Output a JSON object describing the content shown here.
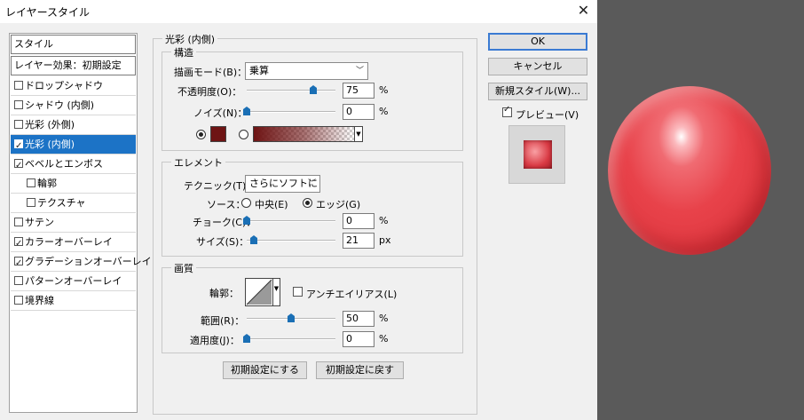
{
  "window": {
    "title": "レイヤースタイル",
    "close_glyph": "✕"
  },
  "list": {
    "header1": "スタイル",
    "header2": "レイヤー効果：初期設定",
    "items": [
      {
        "label": "ドロップシャドウ",
        "checked": false,
        "indent": false,
        "selected": false
      },
      {
        "label": "シャドウ (内側)",
        "checked": false,
        "indent": false,
        "selected": false
      },
      {
        "label": "光彩 (外側)",
        "checked": false,
        "indent": false,
        "selected": false
      },
      {
        "label": "光彩 (内側)",
        "checked": true,
        "indent": false,
        "selected": true
      },
      {
        "label": "ベベルとエンボス",
        "checked": true,
        "indent": false,
        "selected": false
      },
      {
        "label": "輪郭",
        "checked": false,
        "indent": true,
        "selected": false
      },
      {
        "label": "テクスチャ",
        "checked": false,
        "indent": true,
        "selected": false
      },
      {
        "label": "サテン",
        "checked": false,
        "indent": false,
        "selected": false
      },
      {
        "label": "カラーオーバーレイ",
        "checked": true,
        "indent": false,
        "selected": false
      },
      {
        "label": "グラデーションオーバーレイ",
        "checked": true,
        "indent": false,
        "selected": false
      },
      {
        "label": "パターンオーバーレイ",
        "checked": false,
        "indent": false,
        "selected": false
      },
      {
        "label": "境界線",
        "checked": false,
        "indent": false,
        "selected": false
      }
    ]
  },
  "panel": {
    "title": "光彩 (内側)",
    "structure": {
      "title": "構造",
      "blend_label": "描画モード(B)：",
      "blend_value": "乗算",
      "opacity_label": "不透明度(O)：",
      "opacity_value": "75",
      "opacity_unit": "%",
      "opacity": 75,
      "noise_label": "ノイズ(N)：",
      "noise_value": "0",
      "noise_unit": "%",
      "noise": 0,
      "color_swatch": "#6e1414",
      "gradient_from": "#6e1414"
    },
    "elements": {
      "title": "エレメント",
      "technique_label": "テクニック(T)：",
      "technique_value": "さらにソフトに",
      "source_label": "ソース：",
      "center_label": "中央(E)",
      "edge_label": "エッジ(G)",
      "choke_label": "チョーク(C)：",
      "choke_value": "0",
      "choke_unit": "%",
      "choke": 0,
      "size_label": "サイズ(S)：",
      "size_value": "21",
      "size_unit": "px",
      "size": 21
    },
    "quality": {
      "title": "画質",
      "contour_label": "輪郭：",
      "antialias_label": "アンチエイリアス(L)",
      "range_label": "範囲(R)：",
      "range_value": "50",
      "range_unit": "%",
      "range": 50,
      "jitter_label": "適用度(J)：",
      "jitter_value": "0",
      "jitter_unit": "%",
      "jitter": 0
    },
    "make_default": "初期設定にする",
    "reset_default": "初期設定に戻す"
  },
  "buttons": {
    "ok": "OK",
    "cancel": "キャンセル",
    "new_style": "新規スタイル(W)...",
    "preview_label": "プレビュー(V)"
  },
  "colors": {
    "accent": "#1c73c6",
    "thumb": "#1a6fb5",
    "canvas": "#5a5a5a",
    "ball": "#e8424a"
  }
}
